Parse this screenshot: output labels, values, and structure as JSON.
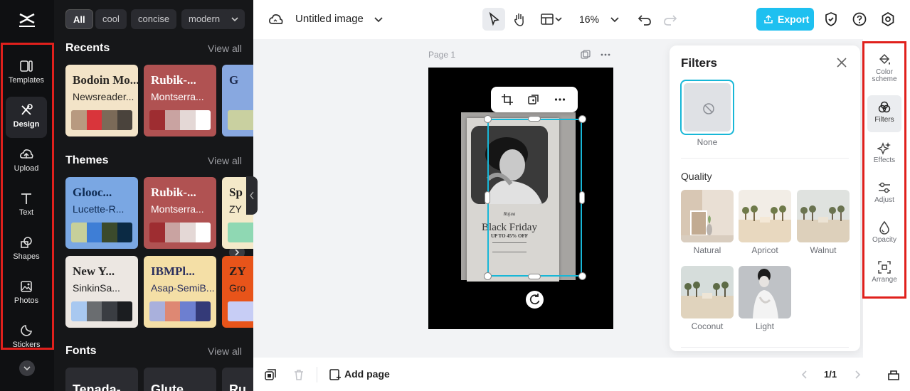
{
  "sidebar": {
    "items": [
      {
        "label": "Templates",
        "icon": "templates-icon"
      },
      {
        "label": "Design",
        "icon": "design-icon",
        "active": true
      },
      {
        "label": "Upload",
        "icon": "upload-icon"
      },
      {
        "label": "Text",
        "icon": "text-icon"
      },
      {
        "label": "Shapes",
        "icon": "shapes-icon"
      },
      {
        "label": "Photos",
        "icon": "photos-icon"
      },
      {
        "label": "Stickers",
        "icon": "stickers-icon"
      }
    ]
  },
  "panel": {
    "chips": [
      "All",
      "cool",
      "concise",
      "modern"
    ],
    "recents": {
      "title": "Recents",
      "view_all": "View all",
      "cards": [
        {
          "font1": "Bodoin Mo...",
          "font2": "Newsreader...",
          "bg": "#f3e4c8",
          "fg": "#2d2a26",
          "swatches": [
            "#b89a80",
            "#d9353b",
            "#7b6a58",
            "#4a433c"
          ]
        },
        {
          "font1": "Rubik-...",
          "font2": "Montserra...",
          "bg": "#b05252",
          "fg": "#ffffff",
          "swatches": [
            "#9e2d31",
            "#c9a3a1",
            "#e4d8d6",
            "#ffffff"
          ]
        },
        {
          "font1": "G",
          "font2": "",
          "bg": "#88a8e0",
          "fg": "#1d2a4d",
          "swatches": [
            "#c9d0a0",
            "#88a8e0"
          ]
        }
      ]
    },
    "themes": {
      "title": "Themes",
      "view_all": "View all",
      "cards": [
        {
          "font1": "Glooc...",
          "font2": "Lucette-R...",
          "bg": "#7aa7e3",
          "fg": "#0e2a52",
          "swatches": [
            "#c7cf9a",
            "#3e7ed6",
            "#3b4a2c",
            "#0b2a44"
          ]
        },
        {
          "font1": "Rubik-...",
          "font2": "Montserra...",
          "bg": "#b05252",
          "fg": "#ffffff",
          "swatches": [
            "#9e2d31",
            "#c9a3a1",
            "#e4d8d6",
            "#ffffff"
          ]
        },
        {
          "font1": "Sp",
          "font2": "ZY",
          "bg": "#f4e9c9",
          "fg": "#1d1d1d",
          "swatches": [
            "#8fd8b3",
            "#f4e9c9"
          ]
        },
        {
          "font1": "New Y...",
          "font2": "SinkinSa...",
          "bg": "#ece7e2",
          "fg": "#222222",
          "swatches": [
            "#a8c8f0",
            "#6a6d70",
            "#3a3d42",
            "#1b1d20"
          ]
        },
        {
          "font1": "IBMPl...",
          "font2": "Asap-SemiB...",
          "bg": "#f4dfa6",
          "fg": "#2a2f5e",
          "swatches": [
            "#a9b0dc",
            "#de8873",
            "#6d7fd0",
            "#343a78"
          ]
        },
        {
          "font1": "ZY",
          "font2": "Gro",
          "bg": "#e8541a",
          "fg": "#1d1d1d",
          "swatches": [
            "#c7cdf5",
            "#e8541a"
          ]
        }
      ]
    },
    "fonts": {
      "title": "Fonts",
      "view_all": "View all",
      "cards": [
        "Tenada-",
        "Glute",
        "Ru"
      ]
    }
  },
  "topbar": {
    "title": "Untitled image",
    "zoom": "16%",
    "export_label": "Export"
  },
  "canvas": {
    "page_label": "Page 1",
    "poster": {
      "script": "Rajua",
      "headline": "Black Friday",
      "sub": "UP TO 45% OFF"
    }
  },
  "filters": {
    "title": "Filters",
    "none_label": "None",
    "quality_title": "Quality",
    "items": [
      {
        "label": "Natural"
      },
      {
        "label": "Apricot"
      },
      {
        "label": "Walnut"
      },
      {
        "label": "Coconut"
      },
      {
        "label": "Light"
      }
    ]
  },
  "tools": {
    "items": [
      {
        "label": "Color scheme",
        "icon": "paint-bucket-icon"
      },
      {
        "label": "Filters",
        "icon": "filters-icon",
        "active": true
      },
      {
        "label": "Effects",
        "icon": "sparkle-icon"
      },
      {
        "label": "Adjust",
        "icon": "sliders-icon"
      },
      {
        "label": "Opacity",
        "icon": "droplet-icon"
      },
      {
        "label": "Arrange",
        "icon": "arrange-icon"
      }
    ]
  },
  "bottombar": {
    "add_page": "Add page",
    "pager": "1/1"
  }
}
